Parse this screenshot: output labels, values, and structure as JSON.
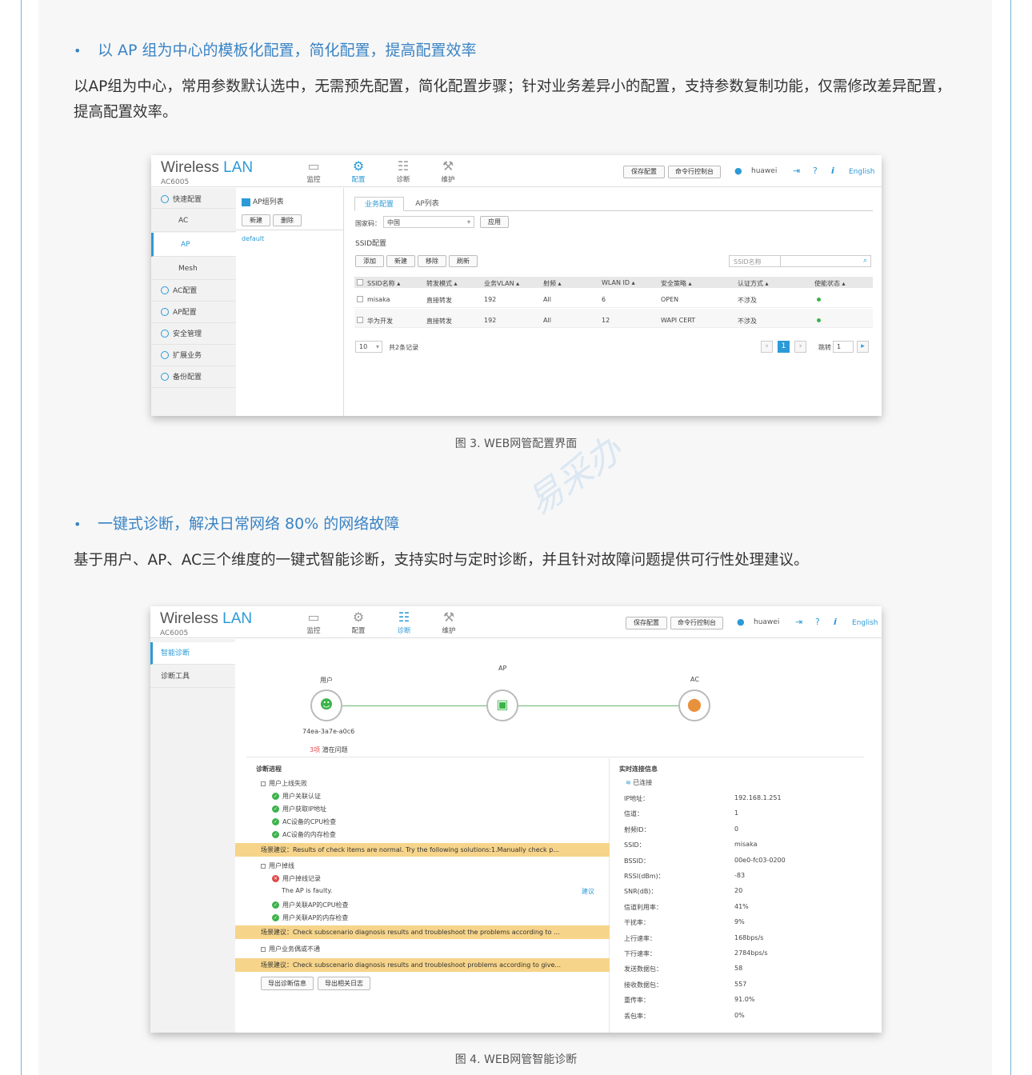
{
  "section1": {
    "bullet": "•",
    "heading": "以 AP 组为中心的模板化配置，简化配置，提高配置效率",
    "paragraph": "以AP组为中心，常用参数默认选中，无需预先配置，简化配置步骤；针对业务差异小的配置，支持参数复制功能，仅需修改差异配置，提高配置效率。"
  },
  "section2": {
    "bullet": "•",
    "heading": "一键式诊断，解决日常网络 80% 的网络故障",
    "paragraph": "基于用户、AP、AC三个维度的一键式智能诊断，支持实时与定时诊断，并且针对故障问题提供可行性处理建议。"
  },
  "captions": {
    "fig3": "图 3. WEB网管配置界面",
    "fig4": "图 4. WEB网管智能诊断"
  },
  "watermark": "易采办",
  "app": {
    "brand_wireless": "Wireless",
    "brand_lan": "LAN",
    "model": "AC6005",
    "nav": {
      "monitor": "监控",
      "config": "配置",
      "diagnose": "诊断",
      "maintain": "维护"
    },
    "save_config": "保存配置",
    "cli": "命令行控制台",
    "user": "huawei",
    "help": "?",
    "info": "i",
    "lang": "English",
    "accent_color": "#2c9ad6"
  },
  "config_screen": {
    "left_nav": {
      "quick": "快速配置",
      "ac": "AC",
      "ap": "AP",
      "mesh": "Mesh",
      "ac_config": "AC配置",
      "ap_config": "AP配置",
      "security": "安全管理",
      "extend": "扩展业务",
      "backup": "备份配置"
    },
    "group_list_title": "AP组列表",
    "btn_new": "新建",
    "btn_delete": "删除",
    "group_default": "default",
    "tabs": {
      "service": "业务配置",
      "ap_list": "AP列表"
    },
    "country_label": "国家码：",
    "country_value": "中国",
    "apply": "应用",
    "ssid_config": "SSID配置",
    "actions": {
      "add": "添加",
      "new": "新建",
      "remove": "移除",
      "refresh": "刷新"
    },
    "ssid_search_placeholder": "SSID名称",
    "columns": [
      "SSID名称",
      "转发模式",
      "业务VLAN",
      "射频",
      "WLAN ID",
      "安全策略",
      "认证方式",
      "使能状态"
    ],
    "rows": [
      [
        "misaka",
        "直接转发",
        "192",
        "All",
        "6",
        "OPEN",
        "不涉及"
      ],
      [
        "华为开发",
        "直接转发",
        "192",
        "All",
        "12",
        "WAPI CERT",
        "不涉及"
      ]
    ],
    "page_size": "10",
    "total": "共2条记录",
    "current_page": "1",
    "jump_label": "跳转",
    "jump_value": "1"
  },
  "diag_screen": {
    "left_nav": {
      "smart": "智能诊断",
      "tools": "诊断工具"
    },
    "nodes": {
      "user": "用户",
      "ap": "AP",
      "ac": "AC"
    },
    "user_mac": "74ea-3a7e-a0c6",
    "issue_count": "3项",
    "issue_text": "潜在问题",
    "progress_title": "诊断进程",
    "group1": "用户上线失败",
    "g1_items": [
      "用户关联认证",
      "用户获取IP地址",
      "AC设备的CPU检查",
      "AC设备的内存检查"
    ],
    "hint1": "场景建议：Results of check items are normal. Try the following solutions:1.Manually check p...",
    "group2": "用户掉线",
    "g2_err": "用户掉线记录",
    "g2_err_detail": "The AP is faulty.",
    "g2_suggest": "建议",
    "g2_items": [
      "用户关联AP的CPU检查",
      "用户关联AP的内存检查"
    ],
    "hint2": "场景建议：Check subscenario diagnosis results and troubleshoot the problems according to ...",
    "group3": "用户业务偶或不通",
    "hint3": "场景建议：Check subscenario diagnosis results and troubleshoot problems according to give...",
    "export_diag": "导出诊断信息",
    "export_log": "导出相关日志",
    "realtime_title": "实时连接信息",
    "connected": "已连接",
    "info": [
      [
        "IP地址：",
        "192.168.1.251"
      ],
      [
        "信道：",
        "1"
      ],
      [
        "射频ID：",
        "0"
      ],
      [
        "SSID：",
        "misaka"
      ],
      [
        "BSSID：",
        "00e0-fc03-0200"
      ],
      [
        "RSSI(dBm)：",
        "-83"
      ],
      [
        "SNR(dB)：",
        "20"
      ],
      [
        "信道利用率：",
        "41%"
      ],
      [
        "干扰率：",
        "9%"
      ],
      [
        "上行速率：",
        "168bps/s"
      ],
      [
        "下行速率：",
        "2784bps/s"
      ],
      [
        "发送数据包：",
        "58"
      ],
      [
        "接收数据包：",
        "557"
      ],
      [
        "重传率：",
        "91.0%"
      ],
      [
        "丢包率：",
        "0%"
      ]
    ]
  }
}
